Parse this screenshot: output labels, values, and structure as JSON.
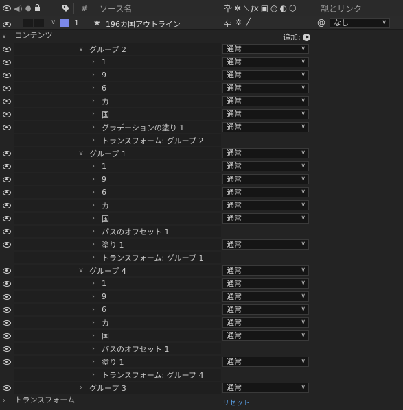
{
  "header": {
    "col_num": "#",
    "source_name": "ソース名",
    "parent": "親とリンク",
    "switch_icons": [
      "puppet-icon",
      "sun-icon",
      "motion-blur-icon",
      "fx-icon",
      "frame-blend-icon",
      "adjust-icon",
      "3d-icon",
      "cube-icon"
    ]
  },
  "layer": {
    "number": "1",
    "color": "#7b88e8",
    "name": "196カ国アウトライン",
    "parent_value": "なし"
  },
  "contents_label": "コンテンツ",
  "add_label": "追加:",
  "reset_label": "リセット",
  "rows": [
    {
      "type": "group",
      "indent": 1,
      "label": "グループ 2",
      "eye": true,
      "mode": "通常"
    },
    {
      "type": "item",
      "indent": 2,
      "label": "1",
      "eye": true,
      "mode": "通常"
    },
    {
      "type": "item",
      "indent": 2,
      "label": "9",
      "eye": true,
      "mode": "通常"
    },
    {
      "type": "item",
      "indent": 2,
      "label": "6",
      "eye": true,
      "mode": "通常"
    },
    {
      "type": "item",
      "indent": 2,
      "label": "カ",
      "eye": true,
      "mode": "通常"
    },
    {
      "type": "item",
      "indent": 2,
      "label": "国",
      "eye": true,
      "mode": "通常"
    },
    {
      "type": "item",
      "indent": 2,
      "label": "グラデーションの塗り 1",
      "eye": true,
      "mode": "通常"
    },
    {
      "type": "item",
      "indent": 2,
      "label": "トランスフォーム: グループ 2",
      "eye": false,
      "mode": ""
    },
    {
      "type": "group",
      "indent": 1,
      "label": "グループ 1",
      "eye": true,
      "mode": "通常"
    },
    {
      "type": "item",
      "indent": 2,
      "label": "1",
      "eye": true,
      "mode": "通常"
    },
    {
      "type": "item",
      "indent": 2,
      "label": "9",
      "eye": true,
      "mode": "通常"
    },
    {
      "type": "item",
      "indent": 2,
      "label": "6",
      "eye": true,
      "mode": "通常"
    },
    {
      "type": "item",
      "indent": 2,
      "label": "カ",
      "eye": true,
      "mode": "通常"
    },
    {
      "type": "item",
      "indent": 2,
      "label": "国",
      "eye": true,
      "mode": "通常"
    },
    {
      "type": "item",
      "indent": 2,
      "label": "パスのオフセット 1",
      "eye": true,
      "mode": ""
    },
    {
      "type": "item",
      "indent": 2,
      "label": "塗り 1",
      "eye": true,
      "mode": "通常"
    },
    {
      "type": "item",
      "indent": 2,
      "label": "トランスフォーム: グループ 1",
      "eye": false,
      "mode": ""
    },
    {
      "type": "group",
      "indent": 1,
      "label": "グループ 4",
      "eye": true,
      "mode": "通常"
    },
    {
      "type": "item",
      "indent": 2,
      "label": "1",
      "eye": true,
      "mode": "通常"
    },
    {
      "type": "item",
      "indent": 2,
      "label": "9",
      "eye": true,
      "mode": "通常"
    },
    {
      "type": "item",
      "indent": 2,
      "label": "6",
      "eye": true,
      "mode": "通常"
    },
    {
      "type": "item",
      "indent": 2,
      "label": "カ",
      "eye": true,
      "mode": "通常"
    },
    {
      "type": "item",
      "indent": 2,
      "label": "国",
      "eye": true,
      "mode": "通常"
    },
    {
      "type": "item",
      "indent": 2,
      "label": "パスのオフセット 1",
      "eye": true,
      "mode": ""
    },
    {
      "type": "item",
      "indent": 2,
      "label": "塗り 1",
      "eye": true,
      "mode": "通常"
    },
    {
      "type": "item",
      "indent": 2,
      "label": "トランスフォーム: グループ 4",
      "eye": false,
      "mode": ""
    },
    {
      "type": "group-collapsed",
      "indent": 1,
      "label": "グループ 3",
      "eye": true,
      "mode": "通常"
    }
  ],
  "transform_label": "トランスフォーム"
}
